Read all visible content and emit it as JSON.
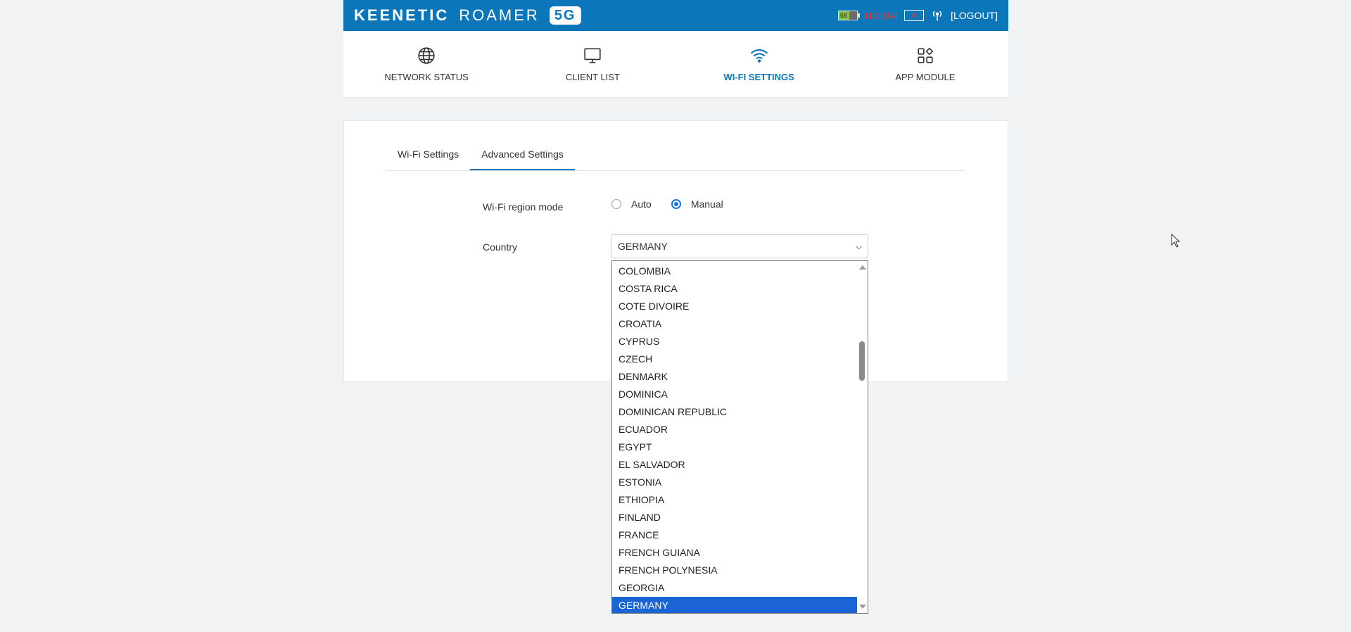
{
  "header": {
    "brand": "KEENETIC",
    "model": "ROAMER",
    "badge": "5G",
    "battery_level": "58",
    "battery_fraction": 0.58,
    "sim_status": "NO SIM",
    "logout_label": "[LOGOUT]"
  },
  "nav": {
    "items": [
      {
        "label": "NETWORK STATUS",
        "icon": "globe-icon"
      },
      {
        "label": "CLIENT LIST",
        "icon": "monitor-icon"
      },
      {
        "label": "WI-FI SETTINGS",
        "icon": "wifi-icon",
        "active": true
      },
      {
        "label": "APP MODULE",
        "icon": "apps-grid-icon"
      }
    ]
  },
  "tabs": [
    {
      "label": "Wi-Fi Settings"
    },
    {
      "label": "Advanced Settings",
      "active": true
    }
  ],
  "form": {
    "region_mode_label": "Wi-Fi region mode",
    "region_options": [
      {
        "label": "Auto",
        "checked": false
      },
      {
        "label": "Manual",
        "checked": true
      }
    ],
    "country_label": "Country",
    "country_value": "GERMANY"
  },
  "dropdown": {
    "options": [
      "COLOMBIA",
      "COSTA RICA",
      "COTE DIVOIRE",
      "CROATIA",
      "CYPRUS",
      "CZECH",
      "DENMARK",
      "DOMINICA",
      "DOMINICAN REPUBLIC",
      "ECUADOR",
      "EGYPT",
      "EL SALVADOR",
      "ESTONIA",
      "ETHIOPIA",
      "FINLAND",
      "FRANCE",
      "FRENCH GUIANA",
      "FRENCH POLYNESIA",
      "GEORGIA",
      "GERMANY"
    ],
    "selected": "GERMANY"
  },
  "colors": {
    "primary": "#0b77ba",
    "selected_option": "#1a64d6",
    "nosim": "#e53935",
    "battery_fill": "#8bc34a"
  }
}
